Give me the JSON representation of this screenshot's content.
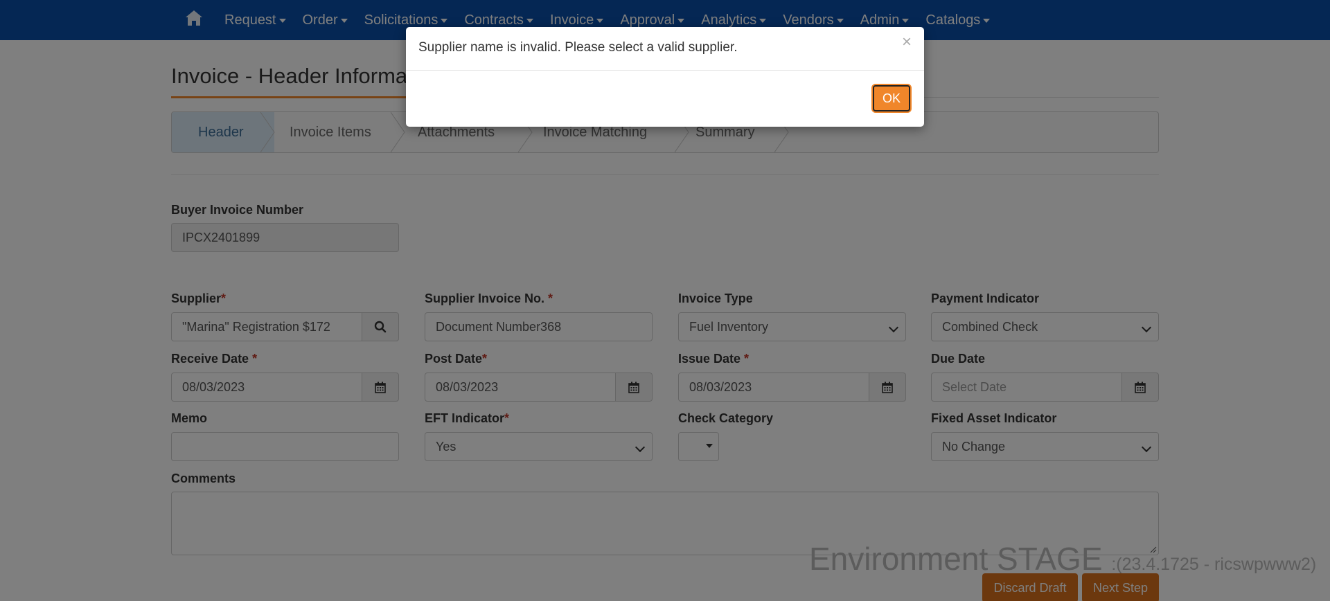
{
  "navbar": {
    "home_icon": "home-icon",
    "items": [
      "Request",
      "Order",
      "Solicitations",
      "Contracts",
      "Invoice",
      "Approval",
      "Analytics",
      "Vendors",
      "Admin",
      "Catalogs"
    ]
  },
  "page": {
    "title": "Invoice - Header Information"
  },
  "wizard": {
    "steps": [
      "Header",
      "Invoice Items",
      "Attachments",
      "Invoice Matching",
      "Summary"
    ],
    "active": "Header"
  },
  "form": {
    "buyer_invoice_number": {
      "label": "Buyer Invoice Number",
      "value": "IPCX2401899"
    },
    "supplier": {
      "label": "Supplier",
      "required": "*",
      "value": "\"Marina\" Registration $172"
    },
    "supplier_invoice_no": {
      "label": "Supplier Invoice No.",
      "required": " *",
      "value": "Document Number368"
    },
    "invoice_type": {
      "label": "Invoice Type",
      "value": "Fuel Inventory"
    },
    "payment_indicator": {
      "label": "Payment Indicator",
      "value": "Combined Check"
    },
    "receive_date": {
      "label": "Receive Date",
      "required": " *",
      "value": "08/03/2023"
    },
    "post_date": {
      "label": "Post Date",
      "required": "*",
      "value": "08/03/2023"
    },
    "issue_date": {
      "label": "Issue Date",
      "required": " *",
      "value": "08/03/2023"
    },
    "due_date": {
      "label": "Due Date",
      "placeholder": "Select Date"
    },
    "memo": {
      "label": "Memo",
      "value": ""
    },
    "eft_indicator": {
      "label": "EFT Indicator",
      "required": "*",
      "value": "Yes"
    },
    "check_category": {
      "label": "Check Category",
      "value": ""
    },
    "fixed_asset_indicator": {
      "label": "Fixed Asset Indicator",
      "value": "No Change"
    },
    "comments": {
      "label": "Comments",
      "value": ""
    }
  },
  "environment": {
    "main": "Environment STAGE",
    "sub": ":(23.4.1725 - ricswpwww2)"
  },
  "buttons": {
    "discard_draft": "Discard Draft",
    "next_step": "Next Step"
  },
  "modal": {
    "message": "Supplier name is invalid. Please select a valid supplier.",
    "close": "×",
    "ok": "OK"
  },
  "colors": {
    "navbar": "#0b4fa8",
    "accent_orange": "#f0862a",
    "button_orange": "#d9711c",
    "required_red": "#c0392b"
  }
}
